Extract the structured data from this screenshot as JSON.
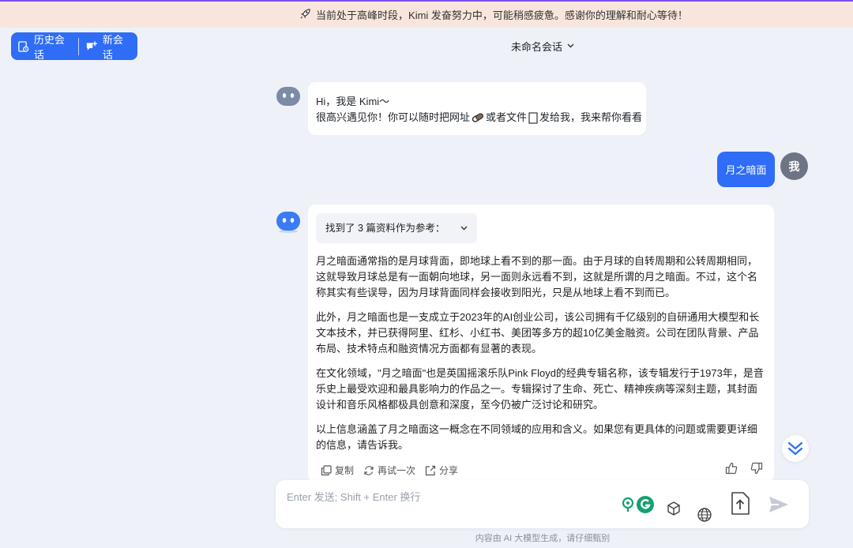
{
  "banner": {
    "text": "当前处于高峰时段，Kimi 发奋努力中，可能稍感疲惫。感谢你的理解和耐心等待！"
  },
  "sidebar": {
    "history_label": "历史会话",
    "new_label": "新会话"
  },
  "header": {
    "title": "未命名会话"
  },
  "greeting": {
    "line1": "Hi，我是 Kimi～",
    "line2_a": "很高兴遇见你！你可以随时把网址",
    "line2_b": "或者文件",
    "line2_c": "发给我，我来帮你看看"
  },
  "user_message": {
    "text": "月之暗面",
    "avatar": "我"
  },
  "answer": {
    "refs_label": "找到了 3 篇资料作为参考：",
    "paragraphs": [
      "月之暗面通常指的是月球背面，即地球上看不到的那一面。由于月球的自转周期和公转周期相同，这就导致月球总是有一面朝向地球，另一面则永远看不到，这就是所谓的月之暗面。不过，这个名称其实有些误导，因为月球背面同样会接收到阳光，只是从地球上看不到而已。",
      "此外，月之暗面也是一支成立于2023年的AI创业公司，该公司拥有千亿级别的自研通用大模型和长文本技术，并已获得阿里、红杉、小红书、美团等多方的超10亿美金融资。公司在团队背景、产品布局、技术特点和融资情况方面都有显著的表现。",
      "在文化领域，\"月之暗面\"也是英国摇滚乐队Pink Floyd的经典专辑名称，该专辑发行于1973年，是音乐史上最受欢迎和最具影响力的作品之一。专辑探讨了生命、死亡、精神疾病等深刻主题，其封面设计和音乐风格都极具创意和深度，至今仍被广泛讨论和研究。",
      "以上信息涵盖了月之暗面这一概念在不同领域的应用和含义。如果您有更具体的问题或需要更详细的信息，请告诉我。"
    ],
    "actions": {
      "copy": "复制",
      "retry": "再试一次",
      "share": "分享"
    }
  },
  "input": {
    "placeholder": "Enter 发送; Shift + Enter 换行"
  },
  "footer": {
    "text": "内容由 AI 大模型生成，请仔细甄别"
  },
  "colors": {
    "accent": "#2f6df6",
    "banner_bg": "#f8e6dc",
    "page_bg": "#eef1f8",
    "grammarly": "#15a070"
  }
}
